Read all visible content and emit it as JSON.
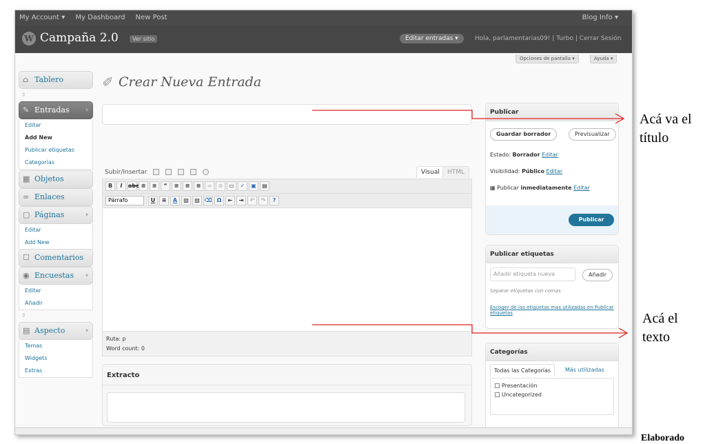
{
  "adminbar": {
    "my_account": "My Account ▾",
    "my_dashboard": "My Dashboard",
    "new_post": "New Post",
    "blog_info": "Blog Info ▾"
  },
  "header": {
    "logo_letter": "W",
    "site_name": "Campaña 2.0",
    "visit": "Ver sitio",
    "edit_entries": "Editar entradas ▾",
    "greeting": "Hola, parlamentarias09! | Turbo | Cerrar Sesión"
  },
  "screen_options": "Opciones de pantalla ▾",
  "help": "Ayuda ▾",
  "sidebar": {
    "tablero": "Tablero",
    "entradas": "Entradas",
    "entradas_sub": [
      "Editar",
      "Add New",
      "Publicar etiquetas",
      "Categorías"
    ],
    "objetos": "Objetos",
    "enlaces": "Enlaces",
    "paginas": "Páginas",
    "paginas_sub": [
      "Editar",
      "Add New"
    ],
    "comentarios": "Comentarios",
    "encuestas": "Encuestas",
    "encuestas_sub": [
      "Editar",
      "Añadir"
    ],
    "aspecto": "Aspecto",
    "aspecto_sub": [
      "Temas",
      "Widgets",
      "Extras"
    ]
  },
  "page_title": "Crear Nueva Entrada",
  "editor": {
    "upload_label": "Subir/Insertar",
    "tab_visual": "Visual",
    "tab_html": "HTML",
    "paragraph": "Párrafo",
    "path": "Ruta: p",
    "word_count": "Word count: 0"
  },
  "extracto": "Extracto",
  "publish": {
    "title": "Publicar",
    "save_draft": "Guardar borrador",
    "preview": "Previsualizar",
    "status_label": "Estado:",
    "status_value": "Borrador",
    "visibility_label": "Visibilidad:",
    "visibility_value": "Público",
    "publish_label": "Publicar",
    "publish_value": "inmediatamente",
    "edit": "Editar",
    "publish_button": "Publicar"
  },
  "tags": {
    "title": "Publicar etiquetas",
    "placeholder": "Añadir etiqueta nueva",
    "add": "Añadir",
    "hint": "Separar etiquetas con comas.",
    "choose": "Escoger de las etiquetas mas utilizadas en Publicar etiquetas"
  },
  "categories": {
    "title": "Categorías",
    "tab_all": "Todas las Categorías",
    "tab_most": "Más utilizadas",
    "items": [
      "Presentación",
      "Uncategorized"
    ]
  },
  "annotations": {
    "title_note_1": "Acá va el",
    "title_note_2": "título",
    "text_note_1": "Acá el",
    "text_note_2": "texto"
  },
  "footer_text": "Elaborado",
  "colors": {
    "arrow": "#e02020",
    "link": "#21759b",
    "header": "#464646"
  }
}
